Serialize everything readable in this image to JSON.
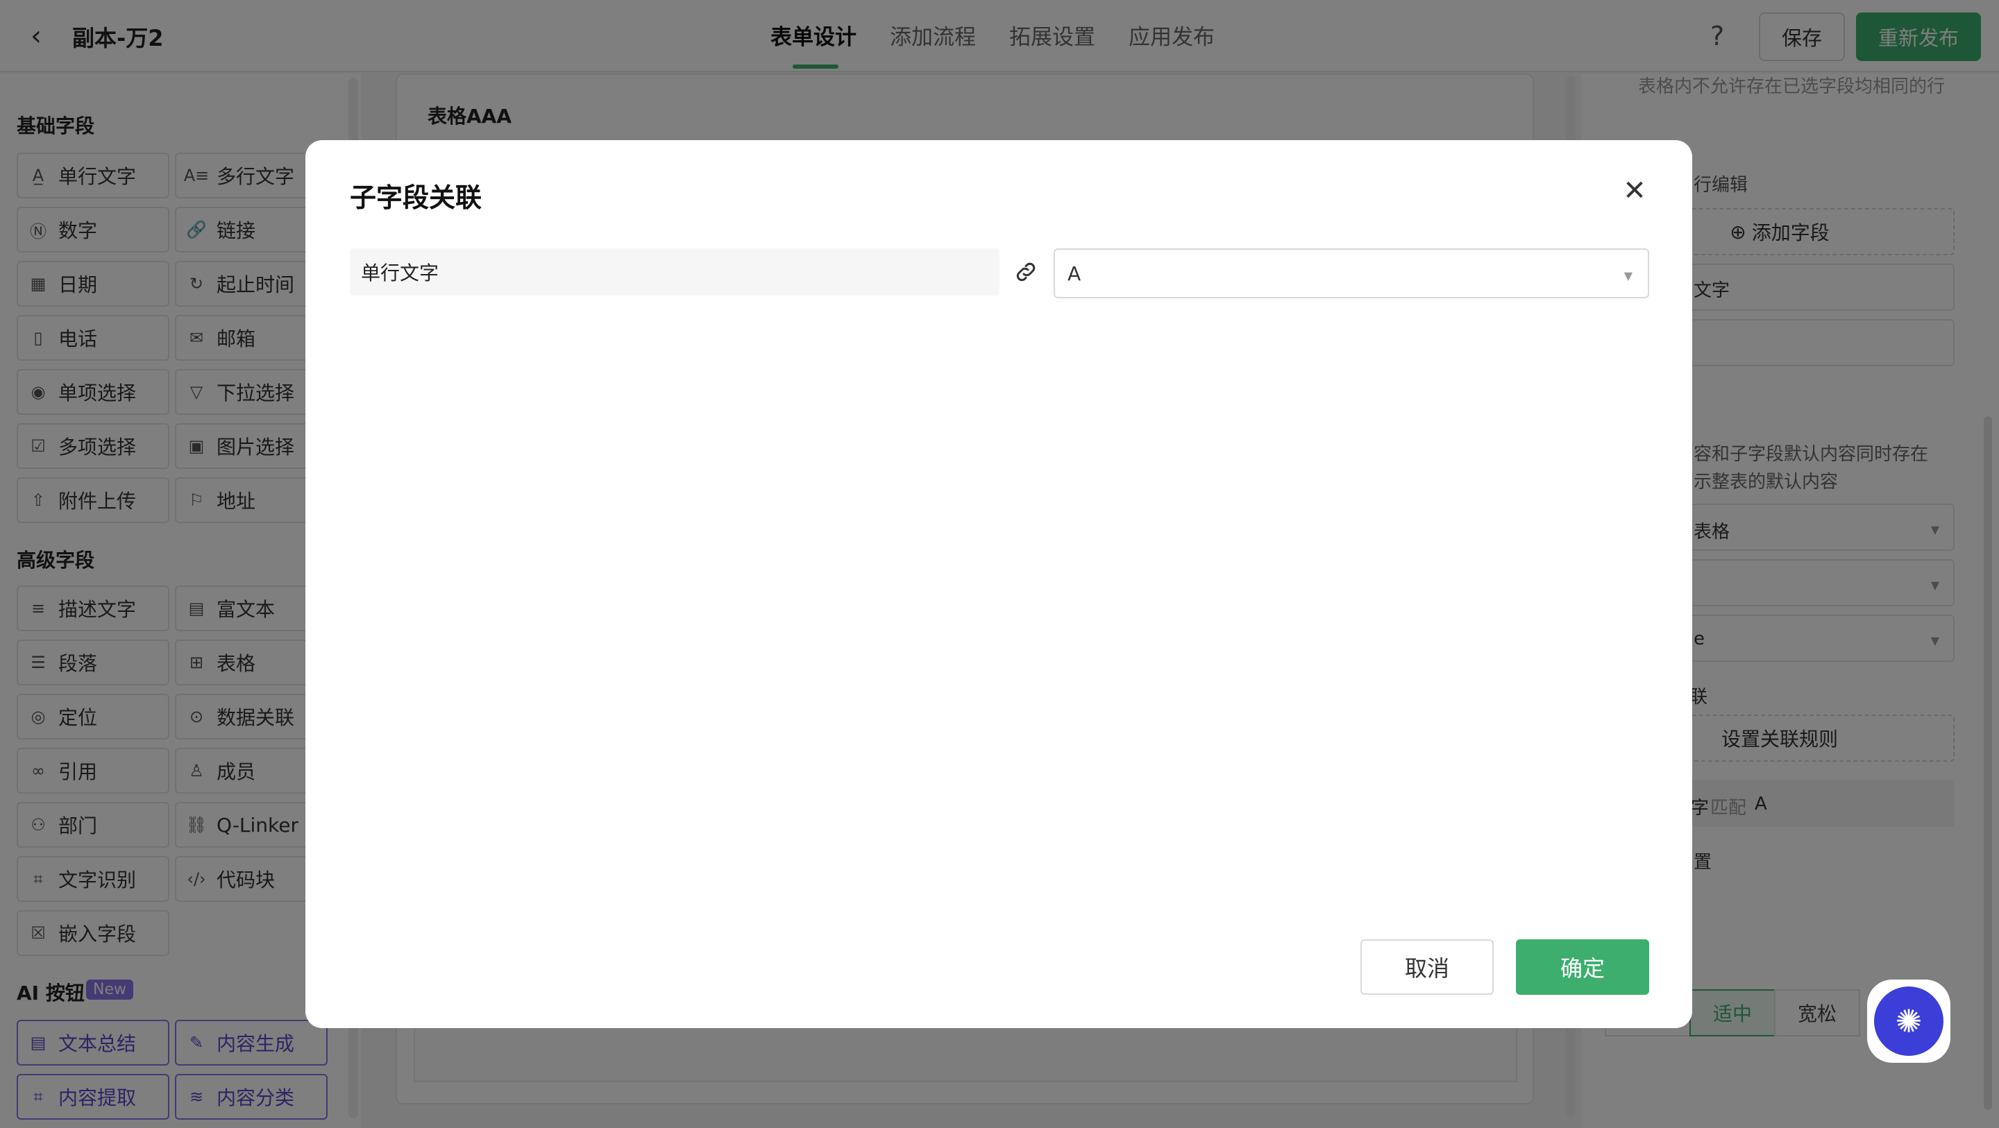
{
  "header": {
    "back_icon": "chevron-left-icon",
    "title": "副本-万2",
    "tabs": [
      {
        "label": "表单设计",
        "active": true
      },
      {
        "label": "添加流程",
        "active": false
      },
      {
        "label": "拓展设置",
        "active": false
      },
      {
        "label": "应用发布",
        "active": false
      }
    ],
    "help": "?",
    "save_label": "保存",
    "publish_label": "重新发布"
  },
  "sidebar": {
    "basic_title": "基础字段",
    "basic_fields": [
      {
        "label": "单行文字",
        "icon": "A̲"
      },
      {
        "label": "多行文字",
        "icon": "A≡"
      },
      {
        "label": "数字",
        "icon": "Ⓝ"
      },
      {
        "label": "链接",
        "icon": "🔗"
      },
      {
        "label": "日期",
        "icon": "▦"
      },
      {
        "label": "起止时间",
        "icon": "↻"
      },
      {
        "label": "电话",
        "icon": "▯"
      },
      {
        "label": "邮箱",
        "icon": "✉"
      },
      {
        "label": "单项选择",
        "icon": "◉"
      },
      {
        "label": "下拉选择",
        "icon": "▽"
      },
      {
        "label": "多项选择",
        "icon": "☑"
      },
      {
        "label": "图片选择",
        "icon": "▣"
      },
      {
        "label": "附件上传",
        "icon": "⇧"
      },
      {
        "label": "地址",
        "icon": "⚐"
      }
    ],
    "advanced_title": "高级字段",
    "advanced_fields": [
      {
        "label": "描述文字",
        "icon": "≡"
      },
      {
        "label": "富文本",
        "icon": "▤"
      },
      {
        "label": "段落",
        "icon": "☰"
      },
      {
        "label": "表格",
        "icon": "⊞"
      },
      {
        "label": "定位",
        "icon": "◎"
      },
      {
        "label": "数据关联",
        "icon": "⊙"
      },
      {
        "label": "引用",
        "icon": "∞"
      },
      {
        "label": "成员",
        "icon": "♙"
      },
      {
        "label": "部门",
        "icon": "⚇"
      },
      {
        "label": "Q-Linker",
        "icon": "⛓"
      },
      {
        "label": "文字识别",
        "icon": "⌗"
      },
      {
        "label": "代码块",
        "icon": "‹/›"
      },
      {
        "label": "嵌入字段",
        "icon": "☒"
      }
    ],
    "ai_title": "AI 按钮",
    "ai_badge": "New",
    "ai_fields": [
      {
        "label": "文本总结",
        "icon": "▤"
      },
      {
        "label": "内容生成",
        "icon": "✎"
      },
      {
        "label": "内容提取",
        "icon": "⌗"
      },
      {
        "label": "内容分类",
        "icon": "≋"
      }
    ]
  },
  "canvas": {
    "table_title": "表格AAA"
  },
  "right_panel": {
    "hint_top": "表格内不允许存在已选字段均相同的行",
    "row_edit": "行编辑",
    "add_field": "添加字段",
    "field_item": "文字",
    "note_line1": "容和子字段默认内容同时存在",
    "note_line2": "示整表的默认内容",
    "select1": "表格",
    "select3": "e",
    "link_label": "联",
    "set_rule": "设置关联规则",
    "rule_prefix": "字",
    "rule_match": "匹配",
    "rule_value": "A",
    "setting_label": "置",
    "density_medium": "适中",
    "density_loose": "宽松"
  },
  "modal": {
    "title": "子字段关联",
    "source_field": "单行文字",
    "link_icon": "link-icon",
    "target_value": "A",
    "cancel_label": "取消",
    "ok_label": "确定"
  },
  "colors": {
    "primary": "#3dae6e",
    "ai_accent": "#8a74e8",
    "assistant": "#3b3fd8"
  }
}
